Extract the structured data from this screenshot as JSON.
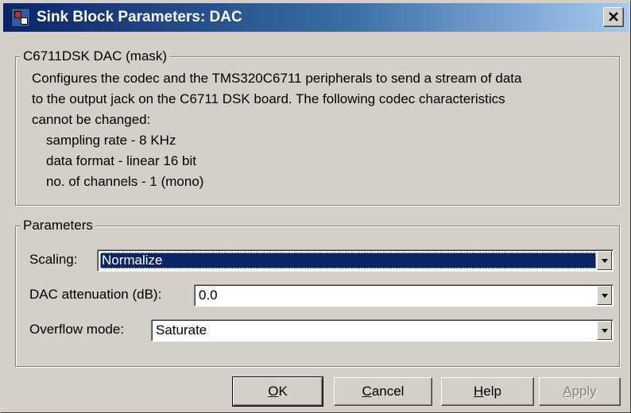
{
  "window": {
    "title": "Sink Block Parameters: DAC",
    "icon": "simulink-block-icon",
    "close_icon": "close-icon"
  },
  "mask_group": {
    "title": "C6711DSK DAC (mask)",
    "description_lines": [
      "Configures the codec and the TMS320C6711 peripherals to send a stream of data",
      "to the output jack on the C6711 DSK board. The  following codec characteristics",
      "cannot be changed:"
    ],
    "characteristics": [
      "sampling rate - 8 KHz",
      "data format - linear 16 bit",
      "no. of channels - 1 (mono)"
    ]
  },
  "parameters_group": {
    "title": "Parameters",
    "scaling": {
      "label": "Scaling:",
      "value": "Normalize",
      "selected": true
    },
    "dac_attenuation": {
      "label": "DAC attenuation (dB):",
      "value": "0.0"
    },
    "overflow_mode": {
      "label": "Overflow mode:",
      "value": "Saturate"
    }
  },
  "buttons": {
    "ok": {
      "mnemonic": "O",
      "rest": "K"
    },
    "cancel": {
      "mnemonic": "C",
      "rest": "ancel"
    },
    "help": {
      "mnemonic": "H",
      "rest": "elp"
    },
    "apply": {
      "mnemonic": "A",
      "rest": "pply",
      "enabled": false
    }
  },
  "colors": {
    "face": "#d4d0c8",
    "titlebar_start": "#0a246a",
    "titlebar_end": "#a6caf0",
    "selection": "#0a246a",
    "disabled_text": "#808080"
  }
}
